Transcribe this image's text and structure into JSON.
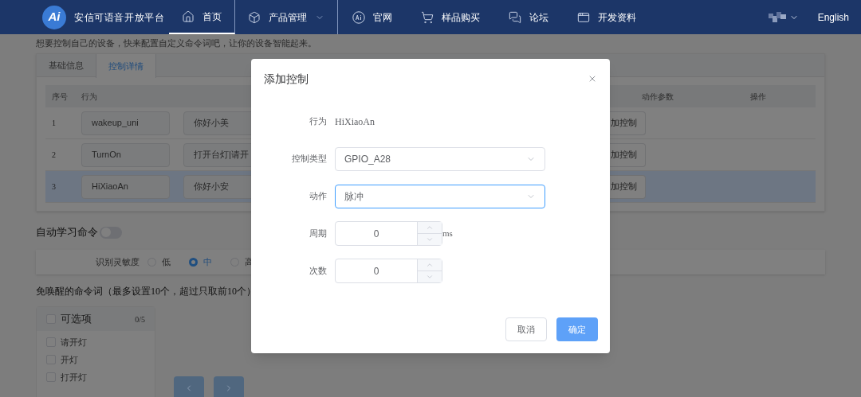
{
  "header": {
    "logo_text": "Ai",
    "title": "安信可语音开放平台",
    "nav": [
      {
        "label": "首页",
        "selected": true,
        "dropdown": false
      },
      {
        "label": "产品管理",
        "selected": false,
        "dropdown": true
      },
      {
        "label": "官网",
        "selected": false,
        "dropdown": false
      },
      {
        "label": "样品购买",
        "selected": false,
        "dropdown": false
      },
      {
        "label": "论坛",
        "selected": false,
        "dropdown": false
      },
      {
        "label": "开发资料",
        "selected": false,
        "dropdown": false
      }
    ],
    "language": "English"
  },
  "intro": "想要控制自己的设备，快来配置自定义命令词吧，让你的设备智能起来。",
  "tabs": [
    {
      "label": "基础信息",
      "selected": false
    },
    {
      "label": "控制详情",
      "selected": true
    }
  ],
  "table": {
    "columns": [
      "序号",
      "行为",
      "动作参数",
      "操作"
    ],
    "rows": [
      {
        "index": "1",
        "behavior": "wakeup_uni",
        "phrases": "你好小美",
        "action": "加控制",
        "selected": false
      },
      {
        "index": "2",
        "behavior": "TurnOn",
        "phrases": "打开台灯|请开",
        "action": "加控制",
        "selected": false
      },
      {
        "index": "3",
        "behavior": "HiXiaoAn",
        "phrases": "你好小安",
        "action": "加控制",
        "selected": true
      }
    ]
  },
  "auto_learn": {
    "label": "自动学习命令",
    "on": false
  },
  "sensitivity": {
    "label": "识别灵敏度",
    "options": [
      {
        "label": "低",
        "selected": false
      },
      {
        "label": "中",
        "selected": true
      },
      {
        "label": "高",
        "selected": false
      }
    ]
  },
  "free_wake": {
    "title": "免唤醒的命令词（最多设置10个，超过只取前10个）",
    "panel": {
      "title": "可选项",
      "count": "0/5",
      "checked": false,
      "items": [
        {
          "label": "请开灯",
          "checked": false
        },
        {
          "label": "开灯",
          "checked": false
        },
        {
          "label": "打开灯",
          "checked": false
        }
      ]
    }
  },
  "dialog": {
    "title": "添加控制",
    "fields": [
      {
        "kind": "text",
        "label": "行为",
        "value": "HiXiaoAn"
      },
      {
        "kind": "select",
        "label": "控制类型",
        "value": "GPIO_A28",
        "focused": false
      },
      {
        "kind": "select",
        "label": "动作",
        "value": "脉冲",
        "focused": true
      },
      {
        "kind": "number",
        "label": "周期",
        "value": "0",
        "unit": "ms"
      },
      {
        "kind": "number",
        "label": "次数",
        "value": "0"
      }
    ],
    "buttons": [
      {
        "label": "取消",
        "primary": false
      },
      {
        "label": "确定",
        "primary": true
      }
    ]
  }
}
